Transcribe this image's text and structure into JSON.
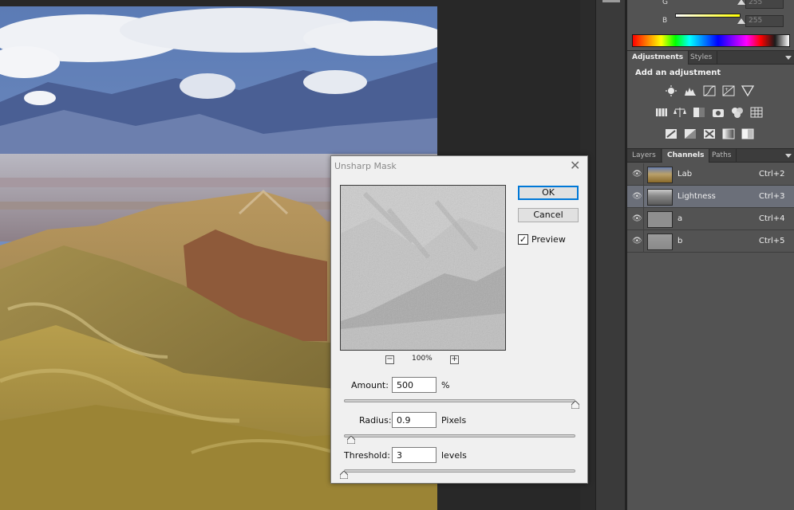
{
  "color_panel": {
    "labels": [
      "G",
      "B"
    ],
    "values": [
      "255",
      "255"
    ],
    "b_slider_fraction": 1.0,
    "accent": "#ffff00"
  },
  "adjustments_panel": {
    "tabs": [
      "Adjustments",
      "Styles"
    ],
    "active_tab": "Adjustments",
    "title": "Add an adjustment",
    "icons": [
      "brightness-contrast-icon",
      "levels-icon",
      "curves-icon",
      "exposure-icon",
      "vibrance-icon",
      "hue-saturation-icon",
      "color-balance-icon",
      "black-white-icon",
      "photo-filter-icon",
      "channel-mixer-icon",
      "color-lookup-icon",
      "invert-icon",
      "posterize-icon",
      "threshold-icon",
      "gradient-map-icon"
    ]
  },
  "layers_panel": {
    "tabs": [
      "Layers",
      "Channels",
      "Paths"
    ],
    "active_tab": "Channels",
    "channels": [
      {
        "name": "Lab",
        "shortcut": "Ctrl+2",
        "selected": false
      },
      {
        "name": "Lightness",
        "shortcut": "Ctrl+3",
        "selected": true
      },
      {
        "name": "a",
        "shortcut": "Ctrl+4",
        "selected": false
      },
      {
        "name": "b",
        "shortcut": "Ctrl+5",
        "selected": false
      }
    ]
  },
  "dialog": {
    "title": "Unsharp Mask",
    "ok_label": "OK",
    "cancel_label": "Cancel",
    "preview_label": "Preview",
    "preview_checked": true,
    "preview_checkmark": "✓",
    "zoom": "100%",
    "zoom_out": "−",
    "zoom_in": "+",
    "close_glyph": "✕",
    "amount": {
      "label": "Amount:",
      "value": "500",
      "unit": "%",
      "slider_fraction": 1.0
    },
    "radius": {
      "label": "Radius:",
      "value": "0.9",
      "unit": "Pixels",
      "slider_fraction": 0.03
    },
    "threshold": {
      "label": "Threshold:",
      "value": "3",
      "unit": "levels",
      "slider_fraction": 0.0
    }
  }
}
